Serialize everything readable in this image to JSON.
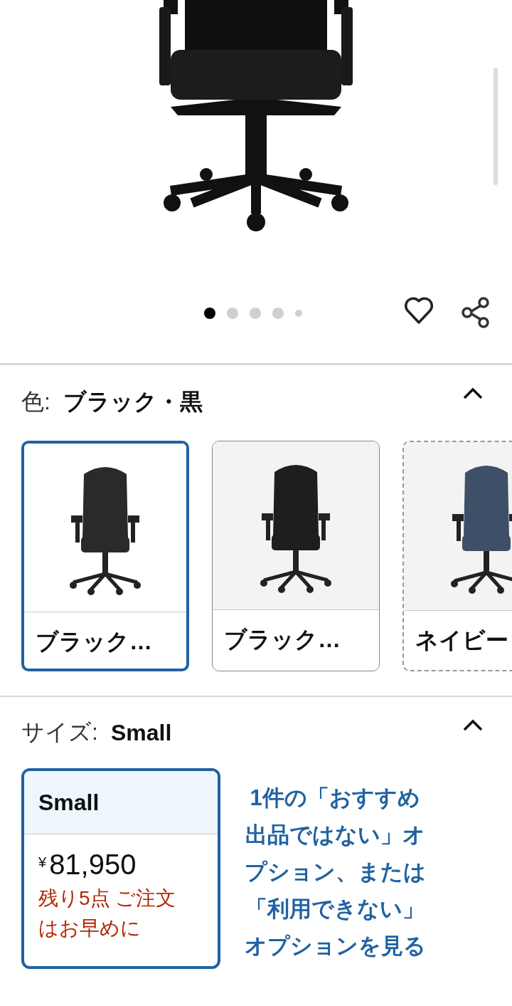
{
  "gallery": {
    "dots": [
      {
        "selected": true
      },
      {
        "selected": false
      },
      {
        "selected": false
      },
      {
        "selected": false
      },
      {
        "selected": false
      }
    ]
  },
  "color": {
    "label": "色:",
    "value": "ブラック・黒",
    "expanded": true,
    "options": [
      {
        "label": "ブラック…",
        "selected": true,
        "available": true,
        "color": "#2a2a2a"
      },
      {
        "label": "ブラック…",
        "selected": false,
        "available": true,
        "color": "#1e1e1e"
      },
      {
        "label": "ネイビー",
        "selected": false,
        "available": false,
        "color": "#3e5068"
      }
    ]
  },
  "size": {
    "label": "サイズ:",
    "value": "Small",
    "expanded": true,
    "options": [
      {
        "name": "Small",
        "selected": true,
        "currency": "¥",
        "price": "81,950",
        "stock": "残り5点 ご注文はお早めに"
      }
    ],
    "other_options_link": "1件の「おすすめ出品ではない」オプション、または「利用できない」オプションを見る"
  }
}
